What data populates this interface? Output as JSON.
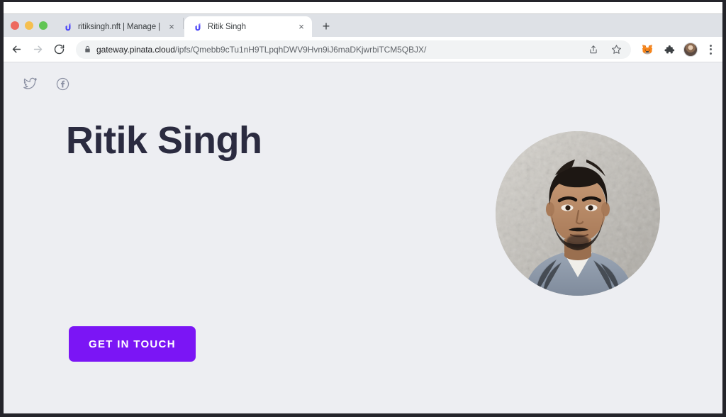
{
  "browser": {
    "window_controls": [
      "close",
      "minimize",
      "maximize"
    ],
    "tabs": [
      {
        "title": "ritiksingh.nft | Manage | Unstop",
        "favicon": "unstoppable-domains-u-icon",
        "active": false,
        "close_label": "×"
      },
      {
        "title": "Ritik Singh",
        "favicon": "unstoppable-domains-u-icon",
        "active": true,
        "close_label": "×"
      }
    ],
    "new_tab_label": "+",
    "nav": {
      "back": "back-arrow-icon",
      "forward": "forward-arrow-icon",
      "reload": "reload-icon"
    },
    "omnibox": {
      "lock": "lock-icon",
      "host": "gateway.pinata.cloud",
      "path": "/ipfs/Qmebb9cTu1nH9TLpqhDWV9Hvn9iJ6maDKjwrbiTCM5QBJX/",
      "share_icon": "share-icon",
      "bookmark_icon": "star-icon"
    },
    "extensions": [
      {
        "name": "metamask-fox-icon"
      },
      {
        "name": "extensions-puzzle-icon"
      }
    ],
    "profile": "profile-avatar",
    "menu": "three-dot-menu-icon"
  },
  "page": {
    "background_color": "#edeef2",
    "social_links": [
      {
        "name": "twitter-icon",
        "label": "Twitter"
      },
      {
        "name": "facebook-icon",
        "label": "Facebook"
      }
    ],
    "title": "Ritik Singh",
    "title_color": "#2b2b40",
    "cta": {
      "label": "GET IN TOUCH",
      "background_color": "#7b15f5",
      "text_color": "#ffffff"
    },
    "portrait": {
      "name": "profile-photo",
      "alt": "Portrait of Ritik Singh in front of a textured stone wall"
    }
  }
}
